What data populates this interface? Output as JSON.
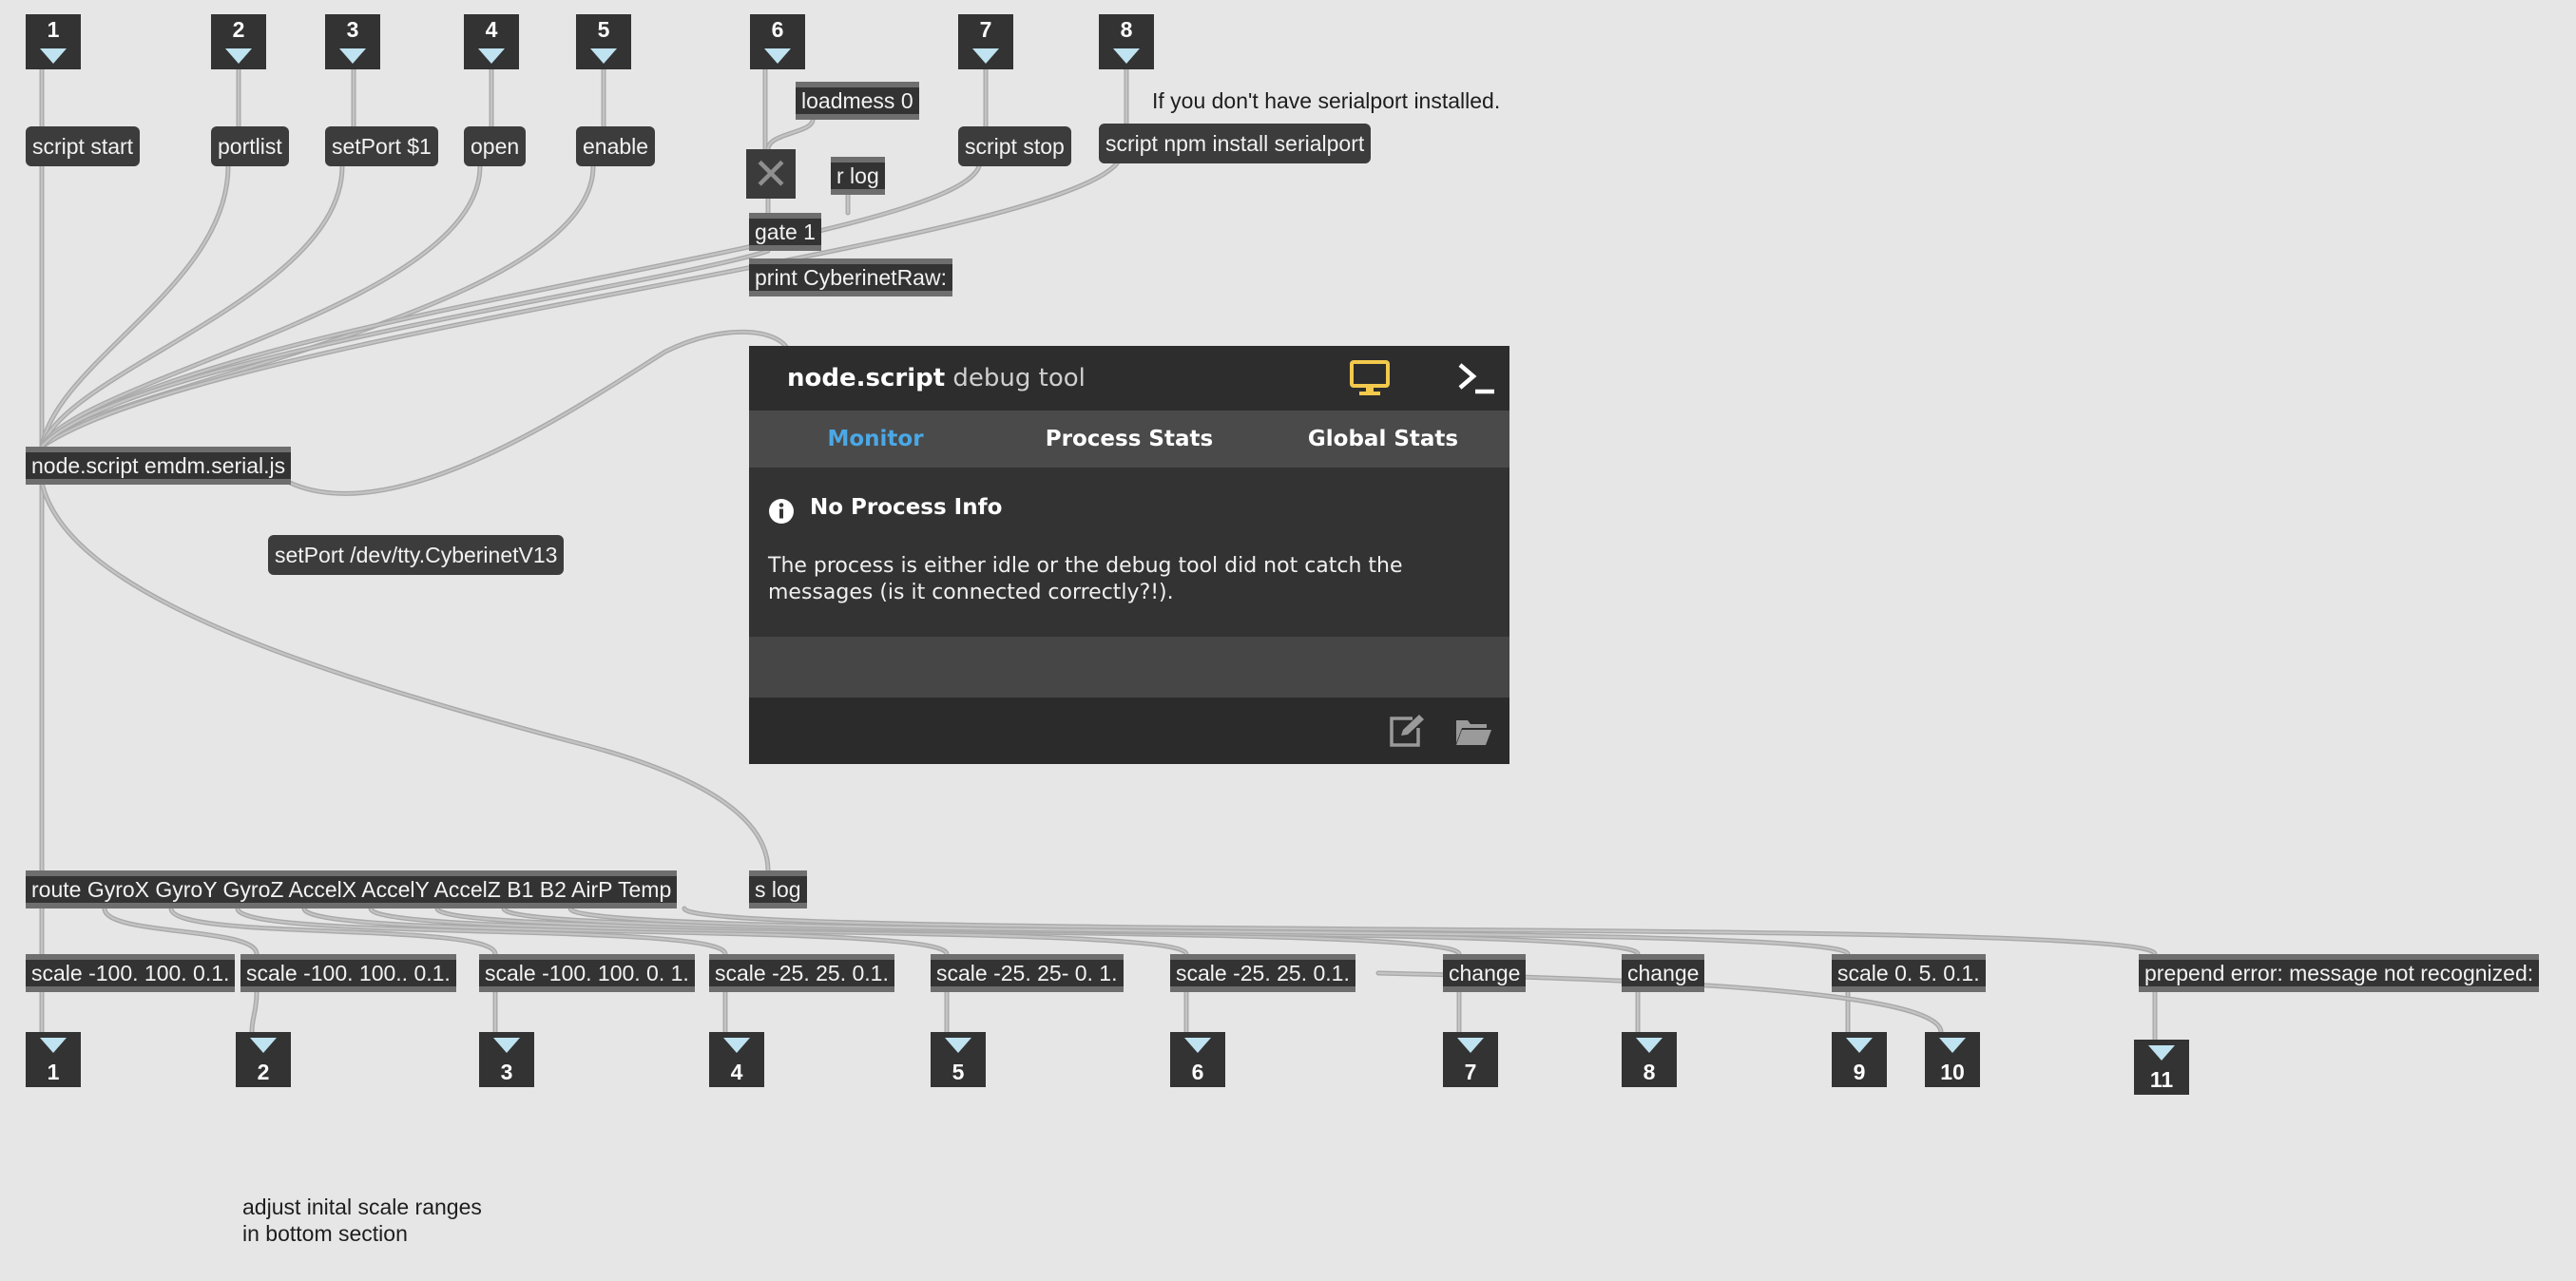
{
  "inlets": [
    "1",
    "2",
    "3",
    "4",
    "5",
    "6",
    "7",
    "8"
  ],
  "messages": {
    "script_start": "script start",
    "portlist": "portlist",
    "setport": "setPort $1",
    "open": "open",
    "enable": "enable",
    "loadmess": "loadmess 0",
    "r_log": "r log",
    "script_stop": "script stop",
    "npm_install": "script npm install serialport",
    "setport_device": "setPort /dev/tty.CyberinetV13"
  },
  "objects": {
    "gate": "gate 1",
    "print": "print CyberinetRaw:",
    "node_script": "node.script emdm.serial.js",
    "route": "route GyroX GyroY GyroZ AccelX AccelY AccelZ B1 B2 AirP Temp",
    "s_log": "s log",
    "scales": [
      "scale -100. 100. 0.1.",
      "scale -100. 100.. 0.1.",
      "scale -100. 100. 0. 1.",
      "scale -25. 25. 0.1.",
      "scale -25. 25- 0. 1.",
      "scale -25. 25. 0.1.",
      "change",
      "change",
      "scale 0. 5. 0.1."
    ],
    "prepend": "prepend error: message not recognized:"
  },
  "outlets": [
    "1",
    "2",
    "3",
    "4",
    "5",
    "6",
    "7",
    "8",
    "9",
    "10",
    "11"
  ],
  "comments": {
    "serialport_note": "If you don't have serialport installed.",
    "adjust_line1": "adjust inital scale ranges",
    "adjust_line2": "in bottom section"
  },
  "debug_tool": {
    "title_bold": "node.script",
    "title_rest": "debug tool",
    "tabs": [
      "Monitor",
      "Process Stats",
      "Global Stats"
    ],
    "active_tab": "Monitor",
    "info_title": "No Process Info",
    "info_text": "The process is either idle or the debug tool did not catch the messages (is it connected correctly?!).",
    "accent_color": "#4aa8e6",
    "monitor_icon_color": "#f2c94c"
  },
  "colors": {
    "canvas": "#e6e6e6",
    "object_fill": "#333333",
    "cord": "#a9a9a9",
    "inlet_arrow": "#bfe3f0"
  },
  "icons": [
    "info-icon",
    "monitor-icon",
    "terminal-icon",
    "edit-icon",
    "folder-icon",
    "close-x-icon"
  ]
}
